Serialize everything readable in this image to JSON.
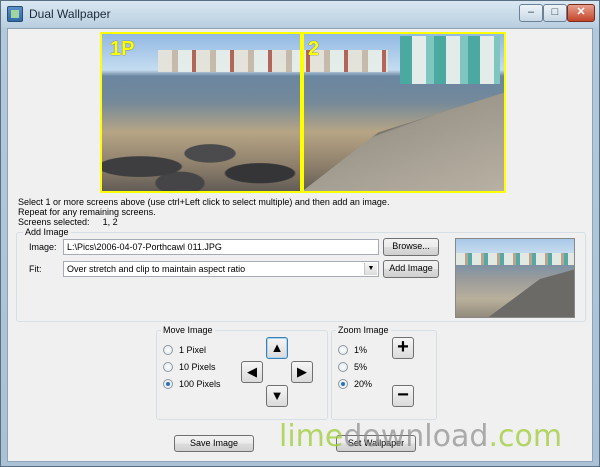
{
  "window": {
    "title": "Dual Wallpaper",
    "controls": {
      "minimize": "–",
      "maximize": "□",
      "close": "✕"
    }
  },
  "preview": {
    "screens": [
      {
        "label": "1P",
        "selected": true
      },
      {
        "label": "2",
        "selected": true
      }
    ],
    "highlight_color": "#ffff00"
  },
  "instructions": {
    "line1": "Select 1 or more screens above (use ctrl+Left click to select multiple) and then add an image.",
    "line2": "Repeat for any remaining screens.",
    "screens_selected_label": "Screens selected:",
    "screens_selected_value": "1, 2"
  },
  "add_image": {
    "title": "Add Image",
    "image_label": "Image:",
    "image_value": "L:\\Pics\\2006-04-07-Porthcawl 011.JPG",
    "browse_label": "Browse...",
    "fit_label": "Fit:",
    "fit_value": "Over stretch and clip to maintain aspect ratio",
    "add_button_label": "Add Image"
  },
  "move_image": {
    "title": "Move Image",
    "options": [
      "1 Pixel",
      "10 Pixels",
      "100 Pixels"
    ],
    "selected": "100 Pixels",
    "arrows": {
      "up": "▲",
      "left": "◀",
      "right": "▶",
      "down": "▼"
    }
  },
  "zoom_image": {
    "title": "Zoom Image",
    "options": [
      "1%",
      "5%",
      "20%"
    ],
    "selected": "20%",
    "zoom_in": "+",
    "zoom_out": "−"
  },
  "footer": {
    "save_label": "Save Image",
    "set_label": "Set Wallpaper"
  },
  "watermark": {
    "part1": "lime",
    "part2": "download",
    "part3": ".com"
  }
}
